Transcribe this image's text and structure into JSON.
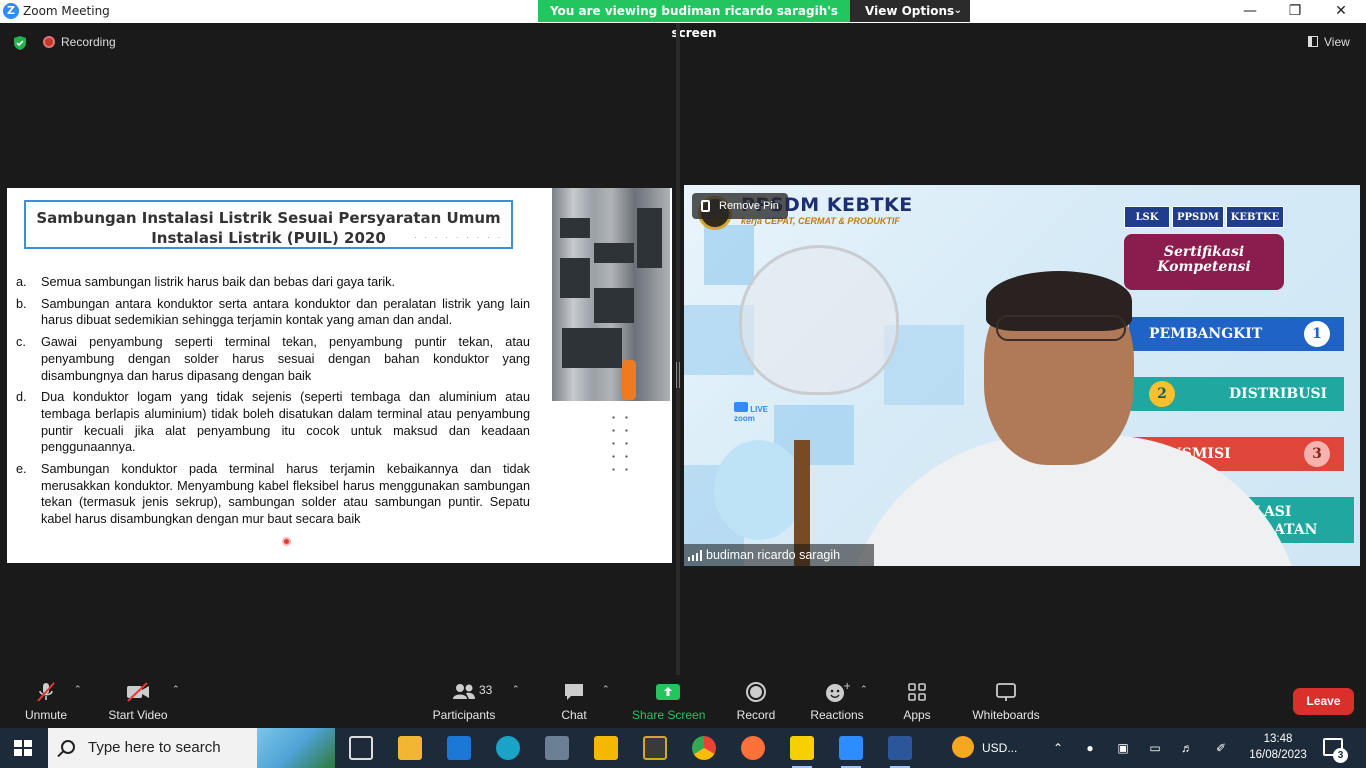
{
  "window": {
    "title": "Zoom Meeting",
    "viewing_banner": "You are viewing budiman ricardo saragih's screen",
    "view_options": "View Options"
  },
  "status": {
    "recording": "Recording",
    "view": "View"
  },
  "slide": {
    "title_line1": "Sambungan Instalasi Listrik Sesuai Persyaratan Umum",
    "title_line2": "Instalasi Listrik (PUIL) 2020",
    "items": [
      {
        "letter": "a.",
        "text": "Semua sambungan listrik harus baik dan bebas dari gaya tarik."
      },
      {
        "letter": "b.",
        "text": "Sambungan antara konduktor serta antara konduktor dan peralatan listrik yang lain harus dibuat sedemikian sehingga terjamin kontak yang aman dan andal."
      },
      {
        "letter": "c.",
        "text": "Gawai penyambung seperti terminal tekan, penyambung puntir tekan, atau penyambung dengan solder harus sesuai dengan bahan konduktor yang disambungnya dan harus dipasang dengan baik"
      },
      {
        "letter": "d.",
        "text": "Dua konduktor logam yang tidak sejenis (seperti tembaga dan aluminium atau tembaga berlapis aluminium) tidak boleh disatukan dalam terminal atau penyambung puntir kecuali jika alat penyambung itu cocok untuk maksud dan keadaan penggunaannya."
      },
      {
        "letter": "e.",
        "text": "Sambungan konduktor pada terminal harus terjamin kebaikannya dan tidak merusakkan konduktor. Menyambung kabel fleksibel harus menggunakan sambungan tekan (termasuk jenis sekrup), sambungan solder atau sambungan puntir. Sepatu kabel harus disambungkan dengan mur baut secara baik"
      }
    ]
  },
  "video": {
    "remove_pin": "Remove Pin",
    "participant_name": "budiman ricardo saragih",
    "background": {
      "logo_text": "PPSDM KEBTKE",
      "logo_sub": "kerja CEPAT, CERMAT & PRODUKTIF",
      "tags": [
        "LSK",
        "PPSDM",
        "KEBTKE"
      ],
      "sertifikasi": [
        "Sertifikasi",
        "Kompetensi"
      ],
      "bands": [
        {
          "label": "PEMBANGKIT",
          "num": "1",
          "color": "#1f63c7"
        },
        {
          "label": "DISTRIBUSI",
          "num": "2",
          "color": "#1fa7a0"
        },
        {
          "label": "NSMISI",
          "num": "3",
          "color": "#e0453a"
        },
        {
          "label": "LASI\nFAATAN",
          "num": "",
          "color": "#1fa7a0"
        }
      ],
      "zoom_live": "zoom",
      "live_tag": "LIVE"
    }
  },
  "toolbar": {
    "unmute": "Unmute",
    "start_video": "Start Video",
    "participants": "Participants",
    "participants_count": "33",
    "chat": "Chat",
    "share_screen": "Share Screen",
    "record": "Record",
    "reactions": "Reactions",
    "apps": "Apps",
    "whiteboards": "Whiteboards",
    "leave": "Leave"
  },
  "taskbar": {
    "search_placeholder": "Type here to search",
    "weather": "USD...",
    "time": "13:48",
    "date": "16/08/2023",
    "notifications": "3"
  },
  "colors": {
    "accent_green": "#22c55e",
    "leave_red": "#d9302b",
    "zoom_blue": "#2d8cff"
  }
}
